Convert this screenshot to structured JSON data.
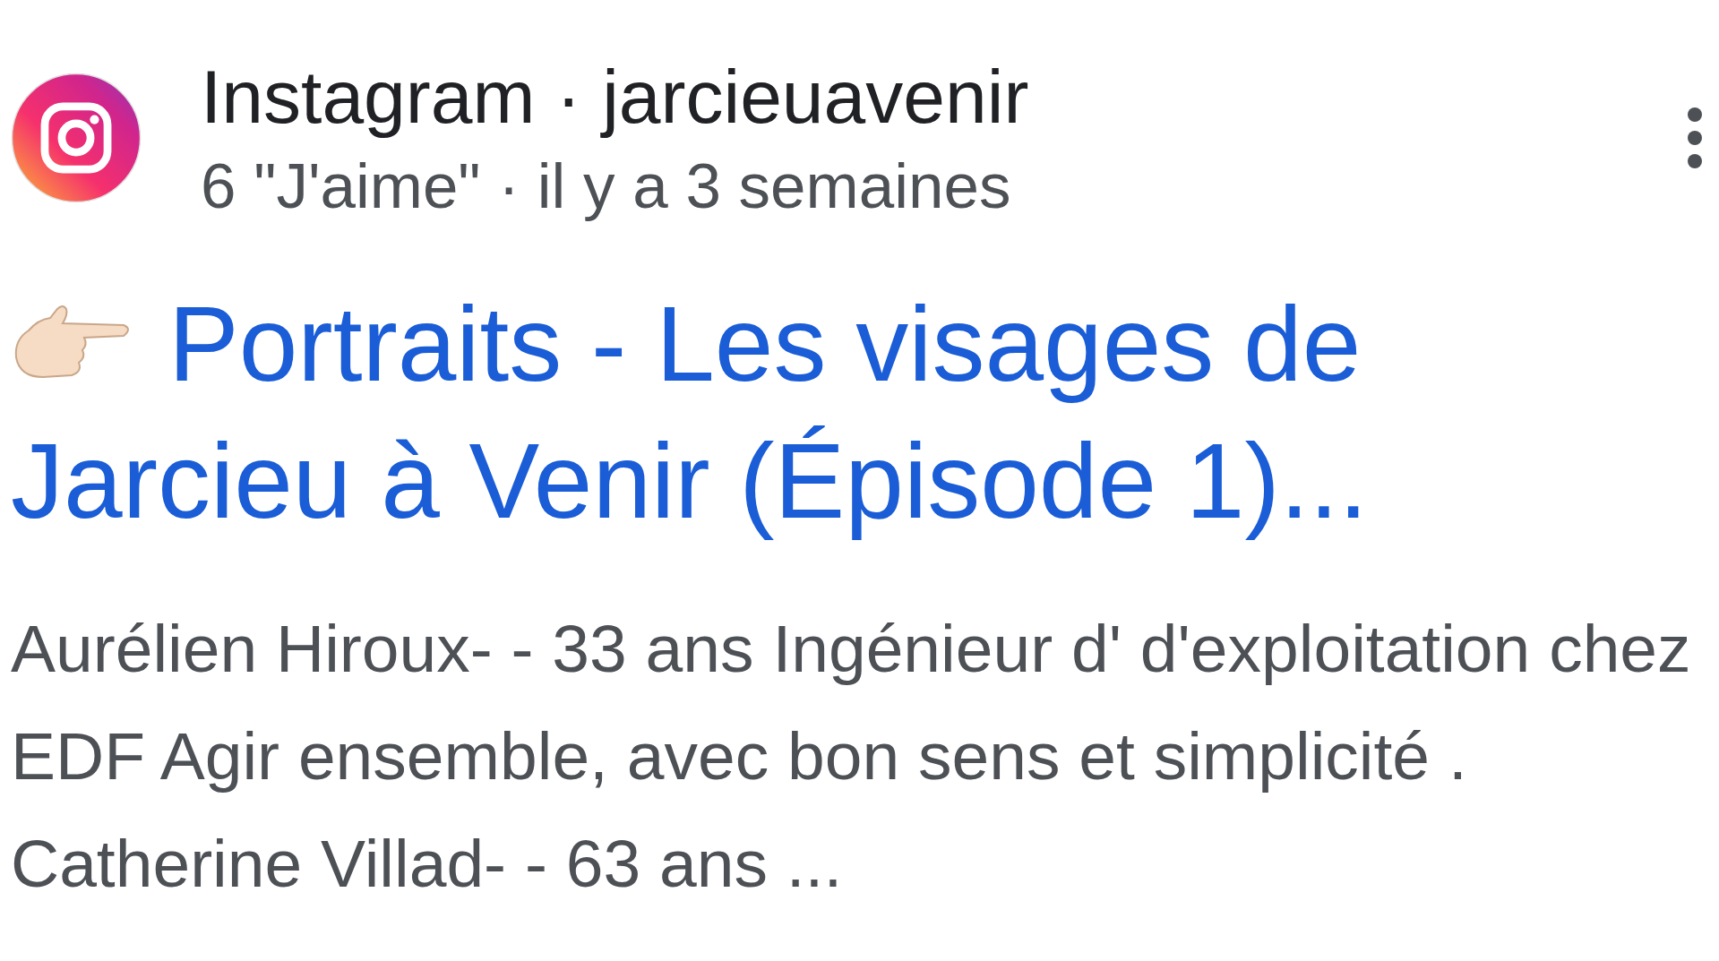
{
  "result": {
    "source": "Instagram",
    "separator": "·",
    "account": "jarcieuavenir",
    "meta": "6 \"J'aime\" · il y a 3 semaines",
    "title": "Portraits - Les visages de Jarcieu à Venir (Épisode 1)...",
    "snippet": "Aurélien Hiroux- - 33 ans Ingénieur d' d'exploitation chez EDF Agir ensemble, avec bon sens et simplicité . Catherine Villad- - 63 ans ..."
  }
}
